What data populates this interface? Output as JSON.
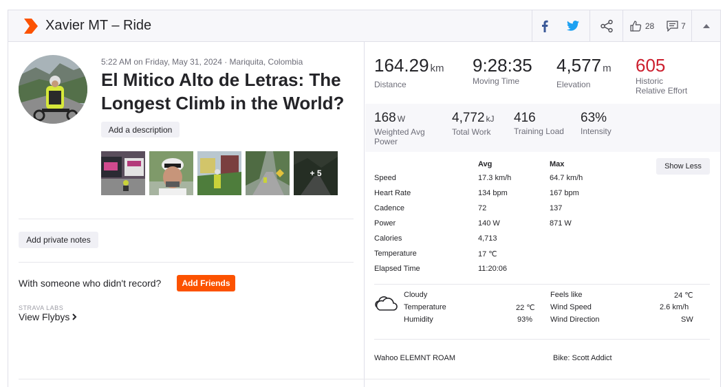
{
  "header": {
    "title": "Xavier MT – Ride",
    "kudos_count": "28",
    "comment_count": "7"
  },
  "activity": {
    "meta": "5:22 AM on Friday, May 31, 2024 · Mariquita, Colombia",
    "title": "El Mitico Alto de Letras: The Longest Climb in the World?",
    "add_description": "Add a description",
    "photos_more": "+ 5",
    "add_private_notes": "Add private notes",
    "with_someone": "With someone who didn't record?",
    "add_friends": "Add Friends",
    "labs": "STRAVA LABS",
    "view_flybys": "View Flybys"
  },
  "primary_stats": [
    {
      "value": "164.29",
      "unit": "km",
      "label": "Distance"
    },
    {
      "value": "9:28:35",
      "unit": "",
      "label": "Moving Time"
    },
    {
      "value": "4,577",
      "unit": "m",
      "label": "Elevation"
    },
    {
      "value": "605",
      "unit": "",
      "label": "Historic",
      "label2": "Relative Effort"
    }
  ],
  "secondary_stats": [
    {
      "value": "168",
      "unit": "W",
      "label": "Weighted Avg",
      "label2": "Power"
    },
    {
      "value": "4,772",
      "unit": "kJ",
      "label": "Total Work"
    },
    {
      "value": "416",
      "unit": "",
      "label": "Training Load"
    },
    {
      "value": "63%",
      "unit": "",
      "label": "Intensity"
    }
  ],
  "table": {
    "col_avg": "Avg",
    "col_max": "Max",
    "show_less": "Show Less",
    "rows": [
      {
        "label": "Speed",
        "avg": "17.3 km/h",
        "max": "64.7 km/h"
      },
      {
        "label": "Heart Rate",
        "avg": "134 bpm",
        "max": "167 bpm"
      },
      {
        "label": "Cadence",
        "avg": "72",
        "max": "137"
      },
      {
        "label": "Power",
        "avg": "140 W",
        "max": "871 W"
      },
      {
        "label": "Calories",
        "avg": "4,713",
        "max": ""
      },
      {
        "label": "Temperature",
        "avg": "17 ℃",
        "max": ""
      },
      {
        "label": "Elapsed Time",
        "avg": "11:20:06",
        "max": ""
      }
    ]
  },
  "weather": {
    "icon": "cloud-icon",
    "condition": "Cloudy",
    "temperature_label": "Temperature",
    "temperature_value": "22 ℃",
    "humidity_label": "Humidity",
    "humidity_value": "93%",
    "feels_like_label": "Feels like",
    "feels_like_value": "24 ℃",
    "wind_speed_label": "Wind Speed",
    "wind_speed_value": "2.6 km/h",
    "wind_direction_label": "Wind Direction",
    "wind_direction_value": "SW"
  },
  "device": "Wahoo ELEMNT ROAM",
  "bike": "Bike: Scott Addict",
  "colors": {
    "brand": "#fc5200",
    "relative_effort": "#cc1e2d",
    "facebook": "#3b5998",
    "twitter": "#1da1f2"
  }
}
